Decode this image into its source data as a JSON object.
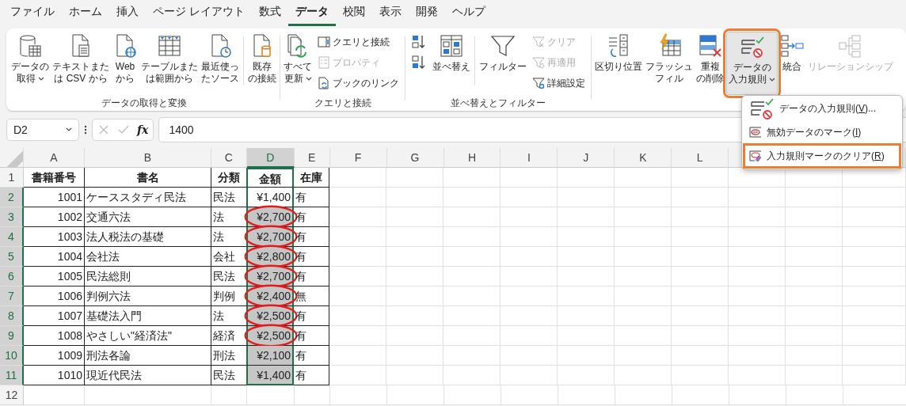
{
  "tabs": [
    {
      "label": "ファイル",
      "selected": false
    },
    {
      "label": "ホーム",
      "selected": false
    },
    {
      "label": "挿入",
      "selected": false
    },
    {
      "label": "ページ レイアウト",
      "selected": false
    },
    {
      "label": "数式",
      "selected": false
    },
    {
      "label": "データ",
      "selected": true
    },
    {
      "label": "校閲",
      "selected": false
    },
    {
      "label": "表示",
      "selected": false
    },
    {
      "label": "開発",
      "selected": false
    },
    {
      "label": "ヘルプ",
      "selected": false
    }
  ],
  "ribbon": {
    "groups": [
      {
        "label": "データの取得と変換",
        "items": [
          {
            "kind": "large",
            "lines": [
              "データの",
              "取得"
            ],
            "dropdown": true
          },
          {
            "kind": "large",
            "lines": [
              "テキストまた",
              "は CSV から"
            ],
            "dropdown": false
          },
          {
            "kind": "large",
            "lines": [
              "Web",
              "から"
            ],
            "dropdown": false
          },
          {
            "kind": "large",
            "lines": [
              "テーブルまた",
              "は範囲から"
            ],
            "dropdown": false
          },
          {
            "kind": "large",
            "lines": [
              "最近使っ",
              "たソース"
            ],
            "dropdown": false
          },
          {
            "kind": "large",
            "lines": [
              "既存",
              "の接続"
            ],
            "dropdown": false
          }
        ]
      },
      {
        "label": "クエリと接続",
        "items": [
          {
            "kind": "large",
            "lines": [
              "すべて",
              "更新"
            ],
            "dropdown": true
          },
          {
            "kind": "stack",
            "items": [
              {
                "label": "クエリと接続",
                "disabled": false
              },
              {
                "label": "プロパティ",
                "disabled": true
              },
              {
                "label": "ブックのリンク",
                "disabled": false
              }
            ]
          }
        ]
      },
      {
        "label": "並べ替えとフィルター",
        "items": [
          {
            "kind": "sort-stack"
          },
          {
            "kind": "large",
            "lines": [
              "並べ替え"
            ],
            "dropdown": false
          },
          {
            "kind": "large",
            "lines": [
              "フィルター"
            ],
            "dropdown": false
          },
          {
            "kind": "stack",
            "items": [
              {
                "label": "クリア",
                "disabled": true
              },
              {
                "label": "再適用",
                "disabled": true
              },
              {
                "label": "詳細設定",
                "disabled": false
              }
            ]
          }
        ]
      },
      {
        "items": [
          {
            "kind": "large",
            "lines": [
              "区切り位置"
            ],
            "dropdown": false,
            "pressed": false,
            "highlighted": false,
            "disabled": false
          },
          {
            "kind": "large",
            "lines": [
              "フラッシュ",
              "フィル"
            ],
            "dropdown": false,
            "pressed": false,
            "highlighted": false,
            "disabled": false
          },
          {
            "kind": "large",
            "lines": [
              "重複",
              "の削除"
            ],
            "dropdown": false,
            "pressed": false,
            "highlighted": false,
            "disabled": false
          },
          {
            "kind": "large",
            "lines": [
              "データの",
              "入力規則"
            ],
            "dropdown": true,
            "pressed": true,
            "highlighted": true,
            "disabled": false
          },
          {
            "kind": "large",
            "lines": [
              "統合"
            ],
            "dropdown": false,
            "pressed": false,
            "highlighted": false,
            "disabled": false
          },
          {
            "kind": "large",
            "lines": [
              "リレーションシップ"
            ],
            "dropdown": false,
            "pressed": false,
            "highlighted": false,
            "disabled": true
          }
        ]
      }
    ]
  },
  "formula_bar": {
    "name_box": "D2",
    "function_label": "fx",
    "value": "1400"
  },
  "menu": {
    "items": [
      {
        "before": "データの入力規則(",
        "key": "V",
        "after": ")...",
        "highlighted": false
      },
      {
        "before": "無効データのマーク(",
        "key": "I",
        "after": ")",
        "highlighted": false
      },
      {
        "before": "入力規則マークのクリア(",
        "key": "R",
        "after": ")",
        "highlighted": true
      }
    ]
  },
  "sheet": {
    "columns": [
      {
        "label": "A",
        "selected": false
      },
      {
        "label": "B",
        "selected": false
      },
      {
        "label": "C",
        "selected": false
      },
      {
        "label": "D",
        "selected": true
      },
      {
        "label": "E",
        "selected": false
      },
      {
        "label": "F",
        "selected": false
      },
      {
        "label": "G",
        "selected": false
      },
      {
        "label": "H",
        "selected": false
      },
      {
        "label": "I",
        "selected": false
      },
      {
        "label": "J",
        "selected": false
      },
      {
        "label": "K",
        "selected": false
      },
      {
        "label": "L",
        "selected": false
      }
    ],
    "rows": [
      {
        "number": "1",
        "kind": "header",
        "selected": false,
        "cells": [
          "書籍番号",
          "書名",
          "分類",
          "金額",
          "在庫"
        ]
      },
      {
        "number": "2",
        "kind": "data",
        "selected": true,
        "active": true,
        "invalid": false,
        "cells": [
          "1001",
          "ケーススタディ民法",
          "民法",
          "¥1,400",
          "有"
        ]
      },
      {
        "number": "3",
        "kind": "data",
        "selected": true,
        "active": false,
        "invalid": true,
        "cells": [
          "1002",
          "交通六法",
          "法",
          "¥2,700",
          "有"
        ]
      },
      {
        "number": "4",
        "kind": "data",
        "selected": true,
        "active": false,
        "invalid": true,
        "cells": [
          "1003",
          "法人税法の基礎",
          "法",
          "¥2,700",
          "有"
        ]
      },
      {
        "number": "5",
        "kind": "data",
        "selected": true,
        "active": false,
        "invalid": true,
        "cells": [
          "1004",
          "会社法",
          "会社",
          "¥2,800",
          "有"
        ]
      },
      {
        "number": "6",
        "kind": "data",
        "selected": true,
        "active": false,
        "invalid": true,
        "cells": [
          "1005",
          "民法総則",
          "民法",
          "¥2,700",
          "有"
        ]
      },
      {
        "number": "7",
        "kind": "data",
        "selected": true,
        "active": false,
        "invalid": true,
        "cells": [
          "1006",
          "判例六法",
          "判例",
          "¥2,400",
          "無"
        ]
      },
      {
        "number": "8",
        "kind": "data",
        "selected": true,
        "active": false,
        "invalid": true,
        "cells": [
          "1007",
          "基礎法入門",
          "法",
          "¥2,500",
          "有"
        ]
      },
      {
        "number": "9",
        "kind": "data",
        "selected": true,
        "active": false,
        "invalid": true,
        "cells": [
          "1008",
          "やさしい\"経済法\"",
          "経済",
          "¥2,500",
          "有"
        ]
      },
      {
        "number": "10",
        "kind": "data",
        "selected": true,
        "active": false,
        "invalid": false,
        "cells": [
          "1009",
          "刑法各論",
          "刑法",
          "¥2,100",
          "有"
        ]
      },
      {
        "number": "11",
        "kind": "data",
        "selected": true,
        "active": false,
        "invalid": false,
        "cells": [
          "1010",
          "現近代民法",
          "民法",
          "¥1,400",
          "有"
        ]
      },
      {
        "number": "12",
        "kind": "empty",
        "selected": false
      }
    ]
  }
}
